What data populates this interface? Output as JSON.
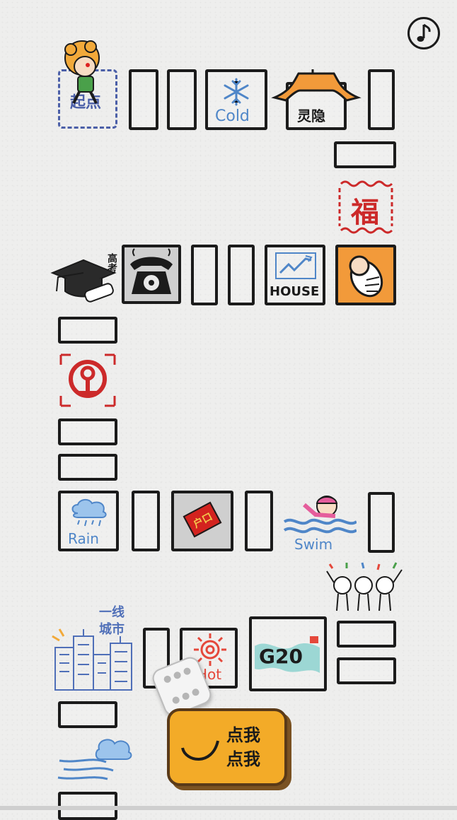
{
  "board": {
    "start_label": "起点",
    "cold_label": "Cold",
    "temple_label": "灵隐",
    "fu_label": "福",
    "gaokao_label": "高考",
    "house_label": "HOUSE",
    "rain_label": "Rain",
    "swim_label": "Swim",
    "city_label_line1": "一线",
    "city_label_line2": "城市",
    "hot_label": "Hot",
    "g20_label": "G20",
    "hukou_label": "户口"
  },
  "controls": {
    "roll_button_line1": "点我",
    "roll_button_line2": "点我",
    "music_icon": "music-note-icon"
  },
  "colors": {
    "tile_border": "#1b1b1b",
    "start_border": "#4b5fa8",
    "accent_orange": "#f2a93a",
    "word_blue": "#4f86c8",
    "stamp_red": "#cc2a2a"
  }
}
